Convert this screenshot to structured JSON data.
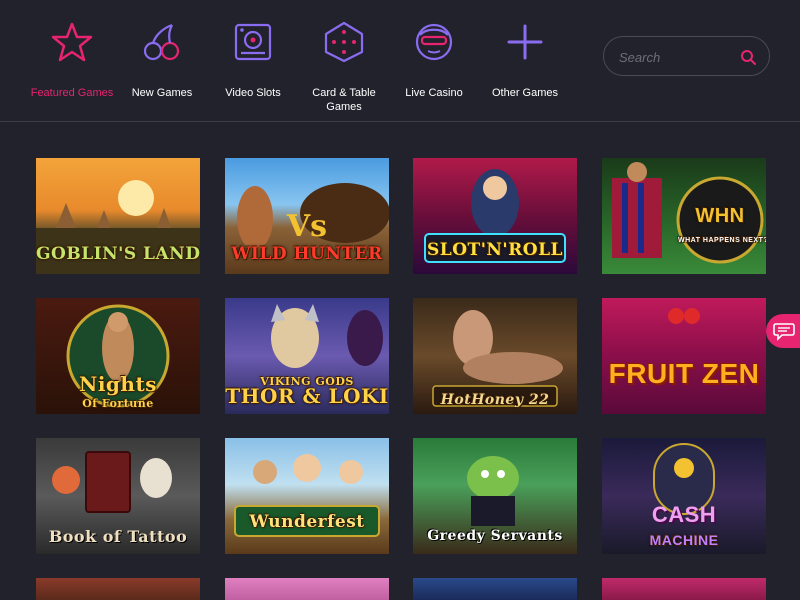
{
  "nav": {
    "categories": [
      {
        "label": "Featured Games",
        "icon": "star-icon"
      },
      {
        "label": "New Games",
        "icon": "cherries-icon"
      },
      {
        "label": "Video Slots",
        "icon": "slot-machine-icon"
      },
      {
        "label": "Card & Table Games",
        "icon": "dice-icon"
      },
      {
        "label": "Live Casino",
        "icon": "dealer-face-icon"
      },
      {
        "label": "Other Games",
        "icon": "plus-icon"
      }
    ]
  },
  "search": {
    "placeholder": "Search",
    "icon": "search-icon"
  },
  "games": [
    {
      "title": "GOBLIN'S LAND",
      "subtitle": ""
    },
    {
      "title": "WILD HUNTER",
      "subtitle": ""
    },
    {
      "title": "SLOT'N'ROLL",
      "subtitle": ""
    },
    {
      "title": "WHN",
      "subtitle": "WHAT HAPPENS NEXT?"
    },
    {
      "title": "Nights",
      "subtitle": "Of Fortune"
    },
    {
      "title": "THOR & LOKI",
      "subtitle": "VIKING GODS"
    },
    {
      "title": "HotHoney 22",
      "subtitle": ""
    },
    {
      "title": "FRUIT ZEN",
      "subtitle": ""
    },
    {
      "title": "Book of Tattoo",
      "subtitle": ""
    },
    {
      "title": "Wunderfest",
      "subtitle": ""
    },
    {
      "title": "Greedy Servants",
      "subtitle": ""
    },
    {
      "title": "CASH",
      "subtitle": "MACHINE"
    }
  ],
  "colors": {
    "accent": "#e6246f",
    "icon_purple": "#8a6cf0",
    "background": "#22222c"
  },
  "chat": {
    "icon": "chat-bubble-icon"
  }
}
